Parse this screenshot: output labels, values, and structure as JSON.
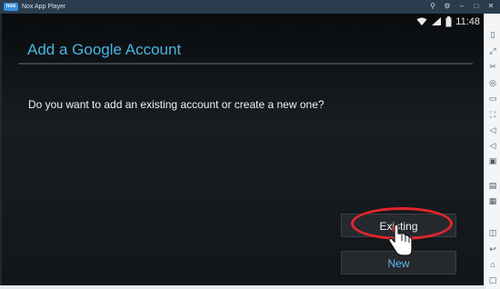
{
  "window": {
    "logo_text": "nox",
    "title": "Nox App Player",
    "controls": [
      "pin-icon",
      "settings-icon",
      "minimize-icon",
      "maximize-icon",
      "close-icon"
    ]
  },
  "statusbar": {
    "icons": [
      "wifi-icon",
      "signal-icon",
      "battery-icon"
    ],
    "time": "11:48"
  },
  "setup": {
    "title": "Add a Google Account",
    "question": "Do you want to add an existing account or create a new one?",
    "existing_label": "Existing",
    "new_label": "New"
  },
  "colors": {
    "title_blue": "#49b6e1",
    "highlight_red": "#e2262b",
    "titlebar": "#2a3c4d"
  },
  "sidebar": {
    "icons": [
      "files-icon",
      "expand-icon",
      "scissors-icon",
      "location-icon",
      "screen-icon",
      "fullscreen-icon",
      "volume-up-icon",
      "volume-down-icon",
      "toolbox-icon",
      "apk-icon",
      "shake-icon",
      "record-icon",
      "back-icon",
      "home-icon",
      "recent-apps-icon"
    ]
  }
}
